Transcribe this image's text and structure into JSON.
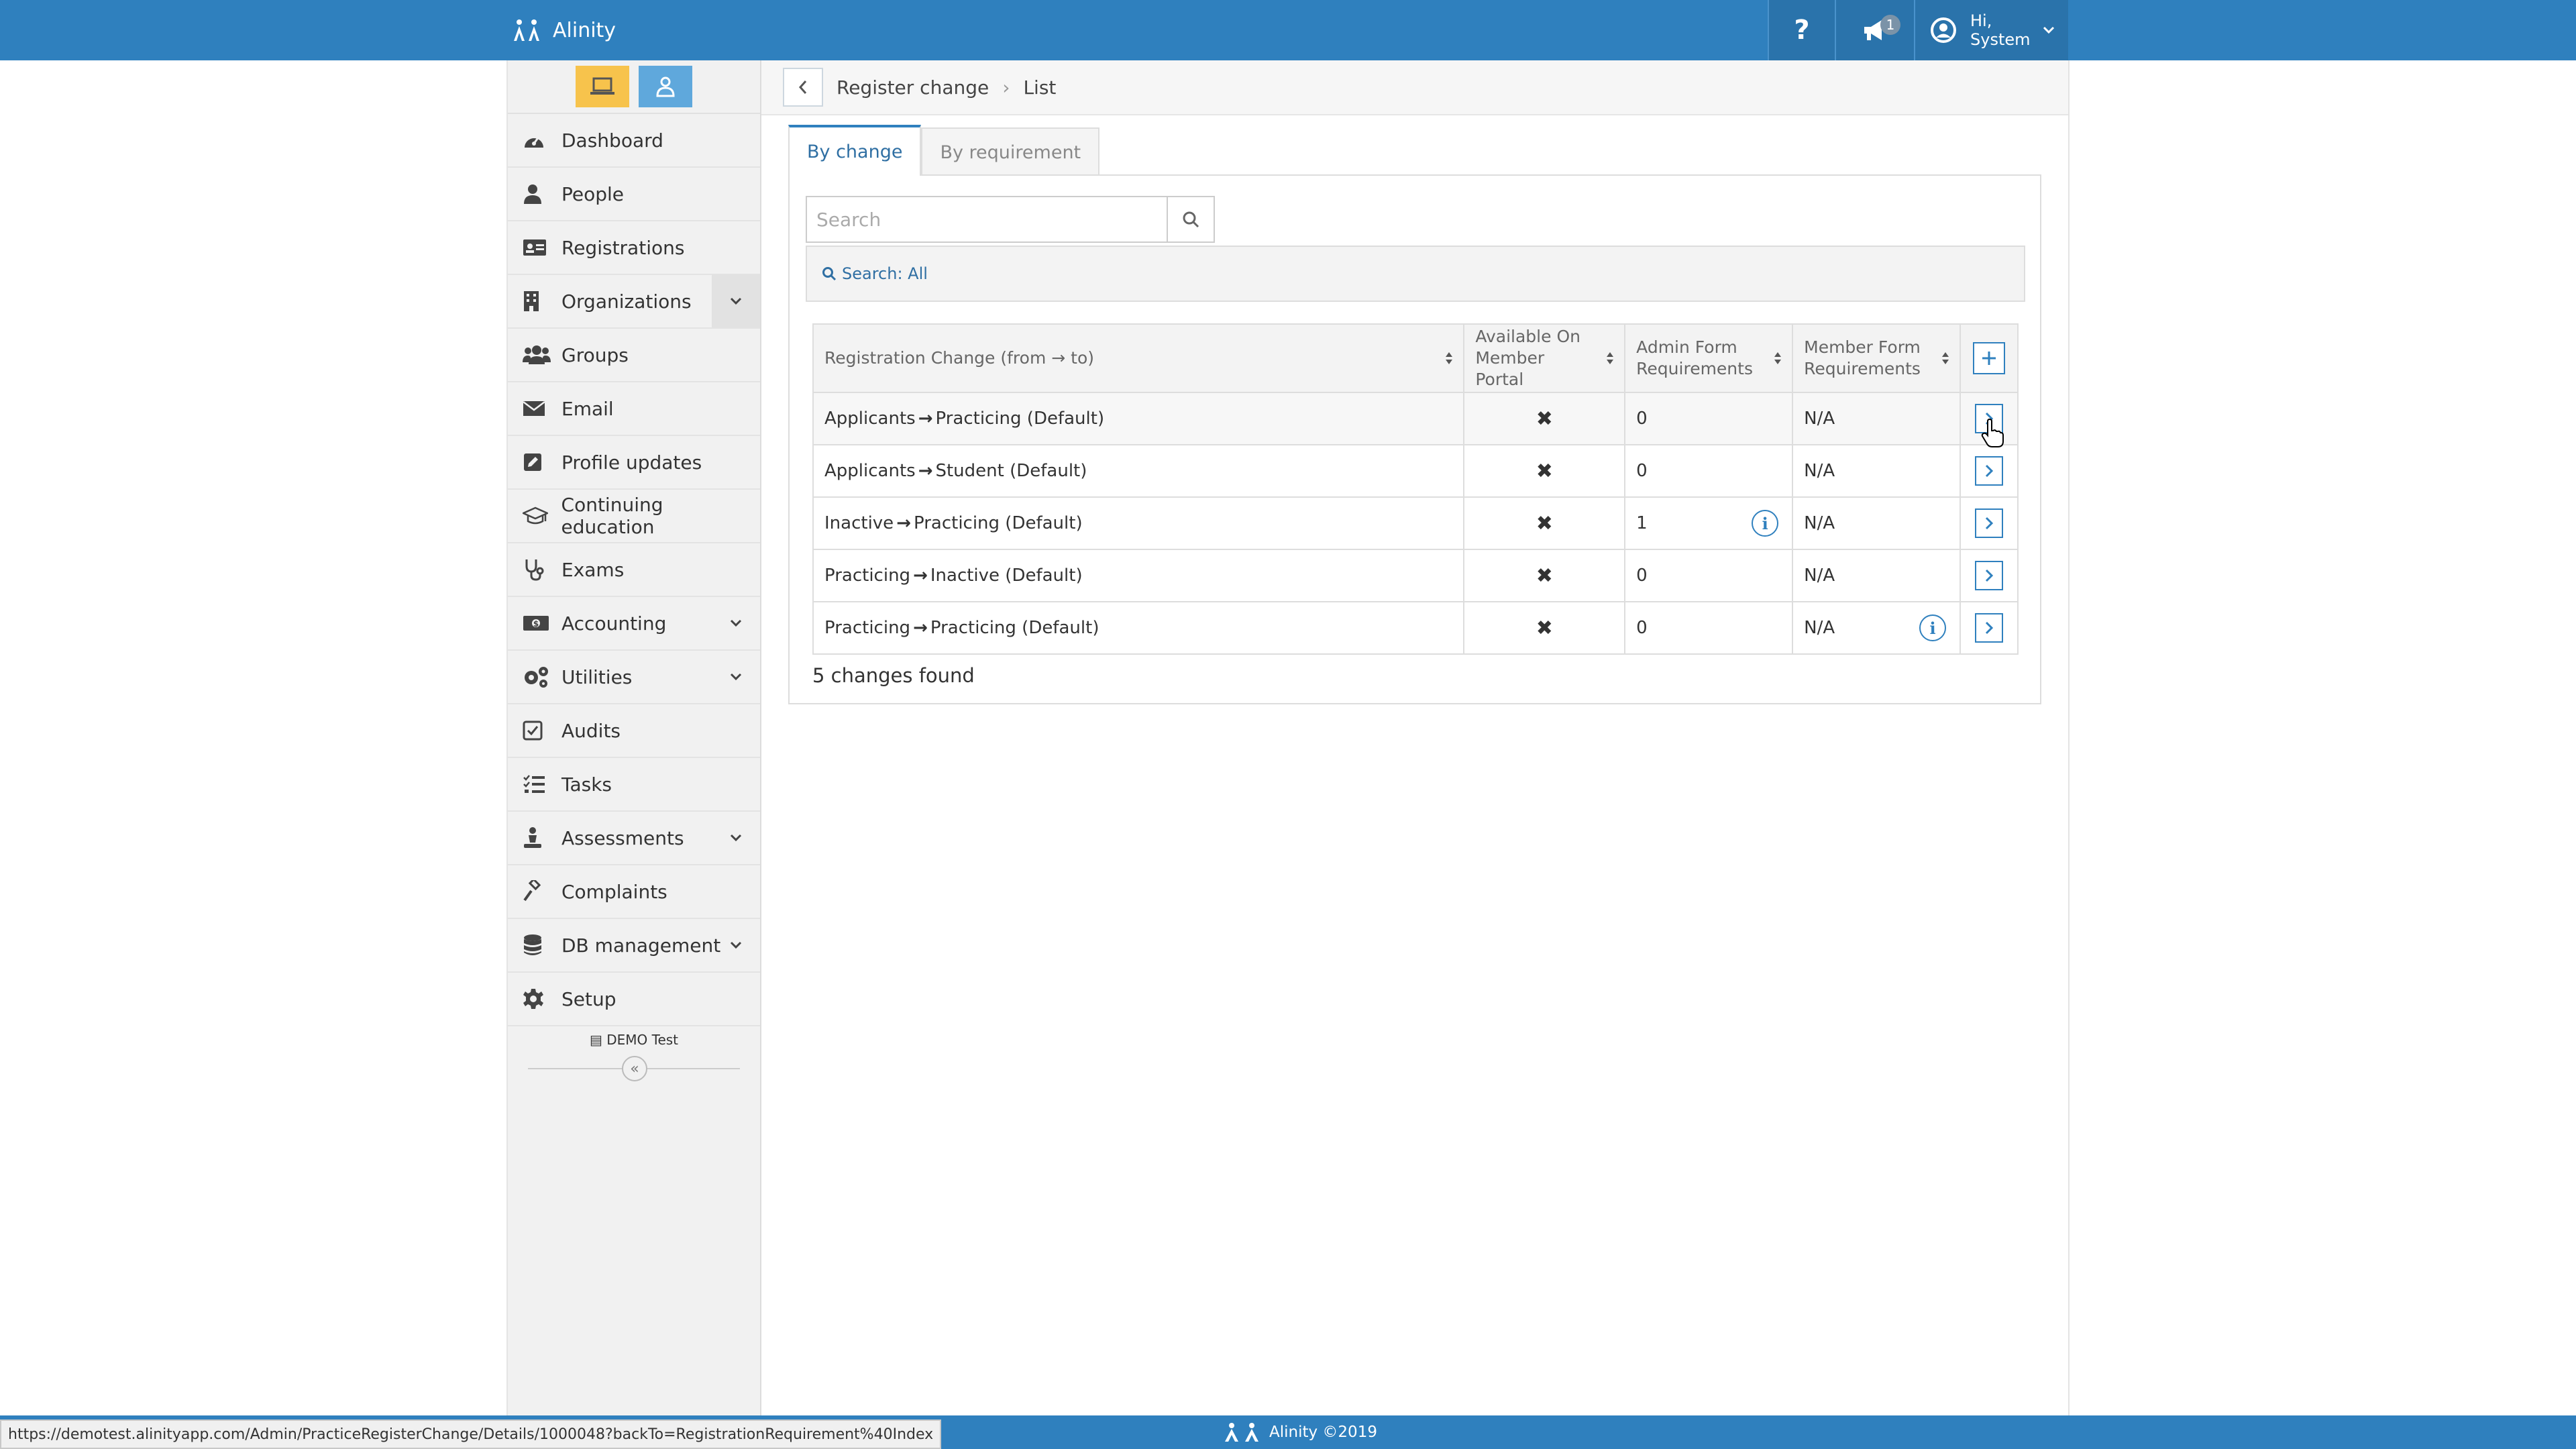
{
  "app": {
    "name": "Alinity"
  },
  "header": {
    "help_label": "?",
    "notification_count": "1",
    "user_greeting": "Hi,",
    "user_name": "System"
  },
  "sidebar": {
    "items": [
      {
        "label": "Dashboard",
        "icon": "dashboard-icon",
        "expandable": false
      },
      {
        "label": "People",
        "icon": "person-icon",
        "expandable": false
      },
      {
        "label": "Registrations",
        "icon": "id-card-icon",
        "expandable": false
      },
      {
        "label": "Organizations",
        "icon": "building-icon",
        "expandable": true
      },
      {
        "label": "Groups",
        "icon": "users-icon",
        "expandable": false
      },
      {
        "label": "Email",
        "icon": "envelope-icon",
        "expandable": false
      },
      {
        "label": "Profile updates",
        "icon": "edit-icon",
        "expandable": false
      },
      {
        "label": "Continuing education",
        "icon": "graduation-cap-icon",
        "expandable": false
      },
      {
        "label": "Exams",
        "icon": "stethoscope-icon",
        "expandable": false
      },
      {
        "label": "Accounting",
        "icon": "money-icon",
        "expandable": true
      },
      {
        "label": "Utilities",
        "icon": "cogs-icon",
        "expandable": true
      },
      {
        "label": "Audits",
        "icon": "check-square-icon",
        "expandable": false
      },
      {
        "label": "Tasks",
        "icon": "tasks-icon",
        "expandable": false
      },
      {
        "label": "Assessments",
        "icon": "assessment-icon",
        "expandable": true
      },
      {
        "label": "Complaints",
        "icon": "gavel-icon",
        "expandable": false
      },
      {
        "label": "DB management",
        "icon": "database-icon",
        "expandable": true
      },
      {
        "label": "Setup",
        "icon": "gear-icon",
        "expandable": false
      }
    ],
    "environment": "DEMO Test",
    "collapse_label": "«"
  },
  "breadcrumb": {
    "parent": "Register change",
    "current": "List"
  },
  "tabs": [
    {
      "label": "By change",
      "active": true
    },
    {
      "label": "By requirement",
      "active": false
    }
  ],
  "search": {
    "placeholder": "Search",
    "value": "",
    "filter_label": "Search: All"
  },
  "table": {
    "columns": [
      "Registration Change (from → to)",
      "Available On Member Portal",
      "Admin Form Requirements",
      "Member Form Requirements"
    ],
    "rows": [
      {
        "from": "Applicants",
        "to": "Practicing (Default)",
        "available": "✖",
        "admin": "0",
        "admin_info": false,
        "member": "N/A",
        "member_info": false
      },
      {
        "from": "Applicants",
        "to": "Student (Default)",
        "available": "✖",
        "admin": "0",
        "admin_info": false,
        "member": "N/A",
        "member_info": false
      },
      {
        "from": "Inactive",
        "to": "Practicing (Default)",
        "available": "✖",
        "admin": "1",
        "admin_info": true,
        "member": "N/A",
        "member_info": false
      },
      {
        "from": "Practicing",
        "to": "Inactive (Default)",
        "available": "✖",
        "admin": "0",
        "admin_info": false,
        "member": "N/A",
        "member_info": false
      },
      {
        "from": "Practicing",
        "to": "Practicing (Default)",
        "available": "✖",
        "admin": "0",
        "admin_info": false,
        "member": "N/A",
        "member_info": true
      }
    ],
    "count_label": "5 changes found"
  },
  "footer": {
    "label": "Alinity ©2019"
  },
  "status_url": "https://demotest.alinityapp.com/Admin/PracticeRegisterChange/Details/1000048?backTo=RegistrationRequirement%40Index",
  "colors": {
    "brand": "#2f80be",
    "desktop_mode": "#f7c34c",
    "user_mode": "#5fa8dc"
  }
}
